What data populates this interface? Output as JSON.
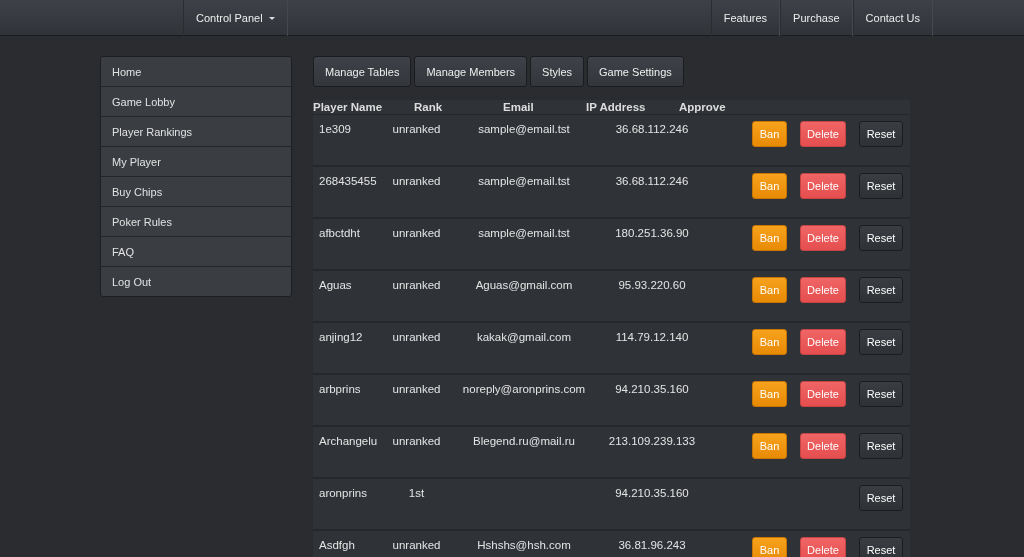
{
  "navbar": {
    "menu": {
      "label": "Control Panel",
      "expanded": false
    },
    "links": [
      {
        "label": "Features"
      },
      {
        "label": "Purchase"
      },
      {
        "label": "Contact Us"
      }
    ]
  },
  "sidebar": {
    "items": [
      {
        "label": "Home"
      },
      {
        "label": "Game Lobby"
      },
      {
        "label": "Player Rankings"
      },
      {
        "label": "My Player"
      },
      {
        "label": "Buy Chips"
      },
      {
        "label": "Poker Rules"
      },
      {
        "label": "FAQ"
      },
      {
        "label": "Log Out"
      }
    ]
  },
  "tabs": [
    {
      "label": "Manage Tables"
    },
    {
      "label": "Manage Members"
    },
    {
      "label": "Styles"
    },
    {
      "label": "Game Settings"
    }
  ],
  "table": {
    "columns": [
      "Player Name",
      "Rank",
      "Email",
      "IP Address",
      "Approve"
    ],
    "rows": [
      {
        "name": "1e309",
        "rank": "unranked",
        "email": "sample@email.tst",
        "ip": "36.68.112.246",
        "buttons": [
          {
            "label": "Ban",
            "kind": "ban"
          },
          {
            "label": "Delete",
            "kind": "delete"
          },
          {
            "label": "Reset",
            "kind": "reset"
          }
        ]
      },
      {
        "name": "268435455",
        "rank": "unranked",
        "email": "sample@email.tst",
        "ip": "36.68.112.246",
        "buttons": [
          {
            "label": "Ban",
            "kind": "ban"
          },
          {
            "label": "Delete",
            "kind": "delete"
          },
          {
            "label": "Reset",
            "kind": "reset"
          }
        ]
      },
      {
        "name": "afbctdht",
        "rank": "unranked",
        "email": "sample@email.tst",
        "ip": "180.251.36.90",
        "buttons": [
          {
            "label": "Ban",
            "kind": "ban"
          },
          {
            "label": "Delete",
            "kind": "delete"
          },
          {
            "label": "Reset",
            "kind": "reset"
          }
        ]
      },
      {
        "name": "Aguas",
        "rank": "unranked",
        "email": "Aguas@gmail.com",
        "ip": "95.93.220.60",
        "buttons": [
          {
            "label": "Ban",
            "kind": "ban"
          },
          {
            "label": "Delete",
            "kind": "delete"
          },
          {
            "label": "Reset",
            "kind": "reset"
          }
        ]
      },
      {
        "name": "anjing12",
        "rank": "unranked",
        "email": "kakak@gmail.com",
        "ip": "114.79.12.140",
        "buttons": [
          {
            "label": "Ban",
            "kind": "ban"
          },
          {
            "label": "Delete",
            "kind": "delete"
          },
          {
            "label": "Reset",
            "kind": "reset"
          }
        ]
      },
      {
        "name": "arbprins",
        "rank": "unranked",
        "email": "noreply@aronprins.com",
        "ip": "94.210.35.160",
        "buttons": [
          {
            "label": "Ban",
            "kind": "ban"
          },
          {
            "label": "Delete",
            "kind": "delete"
          },
          {
            "label": "Reset",
            "kind": "reset"
          }
        ]
      },
      {
        "name": "Archangelu",
        "rank": "unranked",
        "email": "Blegend.ru@mail.ru",
        "ip": "213.109.239.133",
        "buttons": [
          {
            "label": "Ban",
            "kind": "ban"
          },
          {
            "label": "Delete",
            "kind": "delete"
          },
          {
            "label": "Reset",
            "kind": "reset"
          }
        ]
      },
      {
        "name": "aronprins",
        "rank": "1st",
        "ip": "94.210.35.160",
        "buttons": [
          {
            "label": "Reset",
            "kind": "reset"
          }
        ]
      },
      {
        "name": "Asdfgh",
        "rank": "unranked",
        "email": "Hshshs@hsh.com",
        "ip": "36.81.96.243",
        "buttons": [
          {
            "label": "Ban",
            "kind": "ban"
          },
          {
            "label": "Delete",
            "kind": "delete"
          },
          {
            "label": "Reset",
            "kind": "reset"
          }
        ]
      }
    ]
  }
}
